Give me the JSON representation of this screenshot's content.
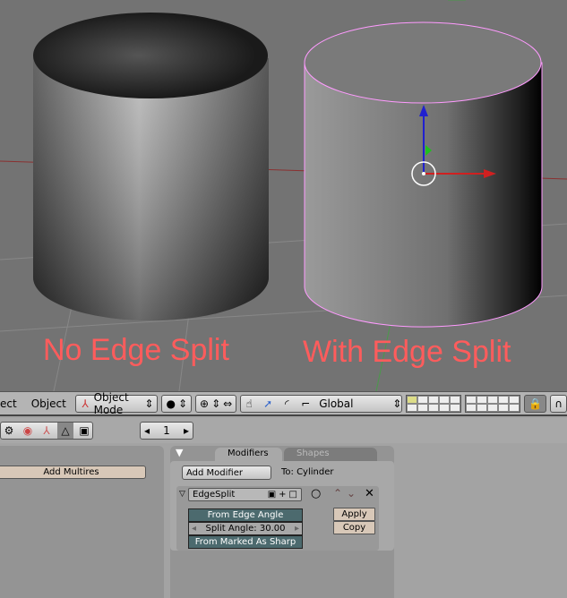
{
  "viewport": {
    "label_left": "No Edge Split",
    "label_right": "With Edge Split",
    "label_color": "#ff5c5c"
  },
  "header": {
    "menu_partial": "ect",
    "menu_object": "Object",
    "mode": "Object Mode",
    "orientation": "Global"
  },
  "subheader": {
    "frame": "1"
  },
  "left_panel": {
    "add_multires": "Add Multires"
  },
  "modifiers": {
    "tab_modifiers": "Modifiers",
    "tab_shapes": "Shapes",
    "add_modifier": "Add Modifier",
    "target": "To: Cylinder",
    "name": "EdgeSplit",
    "from_edge_angle": "From Edge Angle",
    "split_angle": "Split Angle: 30.00",
    "from_marked_sharp": "From Marked As Sharp",
    "apply": "Apply",
    "copy": "Copy"
  }
}
